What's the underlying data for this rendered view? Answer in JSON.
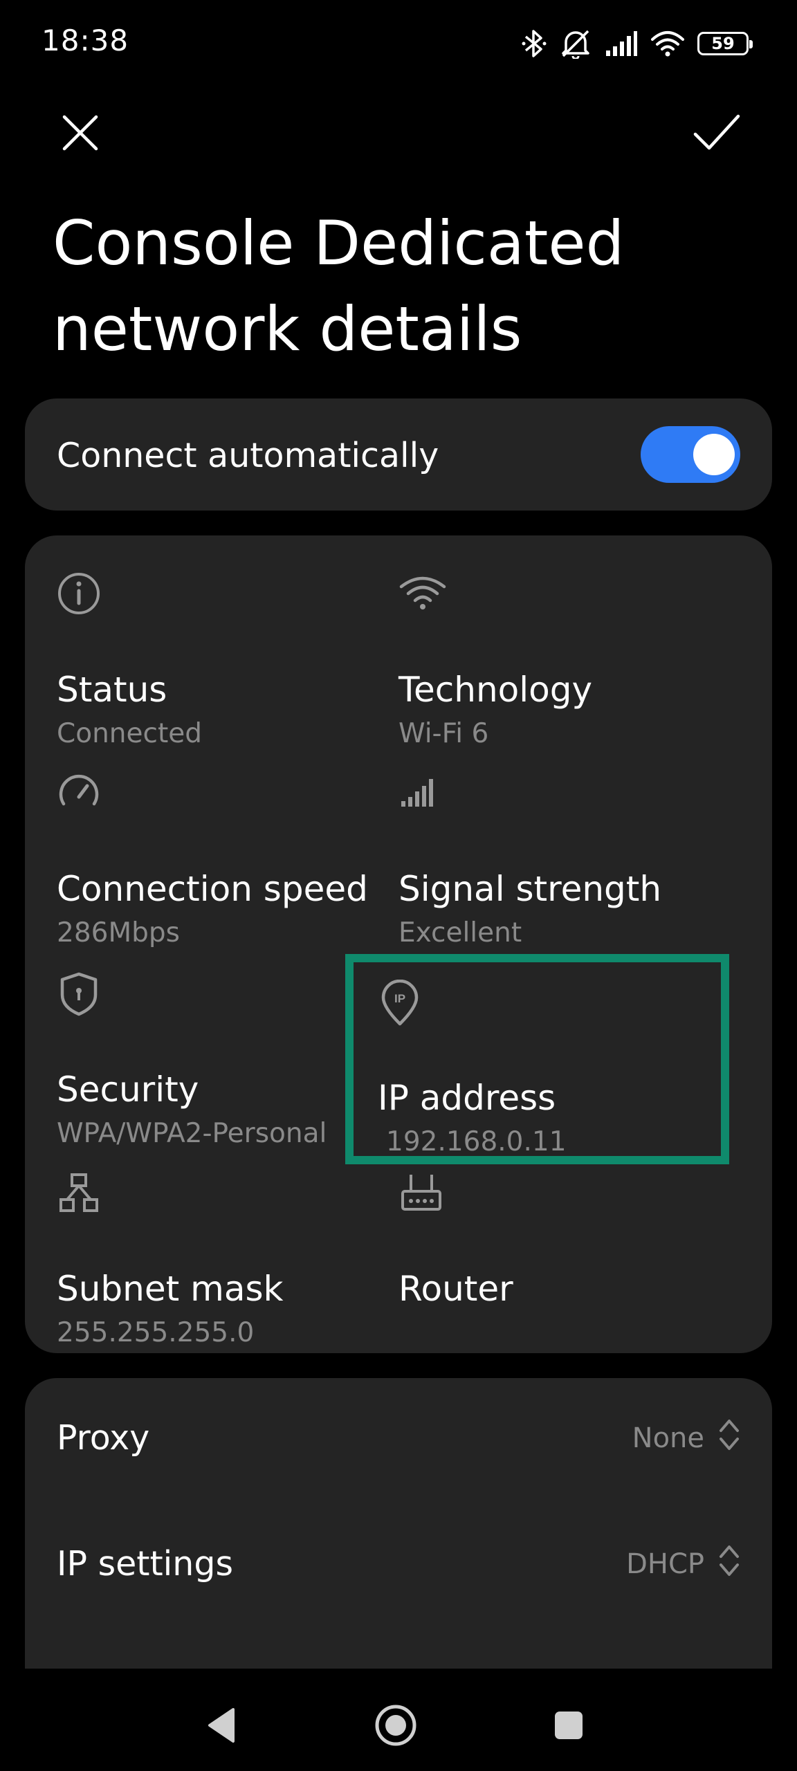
{
  "status_bar": {
    "time": "18:38",
    "battery": "59",
    "icons": [
      "bluetooth-icon",
      "silent-icon",
      "cell-signal-icon",
      "wifi-icon",
      "battery-icon"
    ]
  },
  "header": {
    "close_icon": "close-icon",
    "confirm_icon": "check-icon",
    "title": "Console Dedicated network details"
  },
  "auto_connect": {
    "label": "Connect automatically",
    "enabled": true,
    "accent": "#2f7bf5"
  },
  "details": [
    {
      "icon": "info-icon",
      "label": "Status",
      "value": "Connected"
    },
    {
      "icon": "wifi-icon",
      "label": "Technology",
      "value": "Wi-Fi 6"
    },
    {
      "icon": "speedometer-icon",
      "label": "Connection speed",
      "value": "286Mbps"
    },
    {
      "icon": "signal-bars-icon",
      "label": "Signal strength",
      "value": "Excellent"
    },
    {
      "icon": "shield-icon",
      "label": "Security",
      "value": "WPA/WPA2-Personal"
    },
    {
      "icon": "ip-pin-icon",
      "label": "IP address",
      "value": "192.168.0.11"
    },
    {
      "icon": "network-topology-icon",
      "label": "Subnet mask",
      "value": "255.255.255.0"
    },
    {
      "icon": "router-icon",
      "label": "Router",
      "value": ""
    }
  ],
  "highlight_color": "#0f8a6c",
  "settings": [
    {
      "label": "Proxy",
      "value": "None"
    },
    {
      "label": "IP settings",
      "value": "DHCP"
    }
  ],
  "nav": [
    "back-icon",
    "home-icon",
    "recents-icon"
  ]
}
